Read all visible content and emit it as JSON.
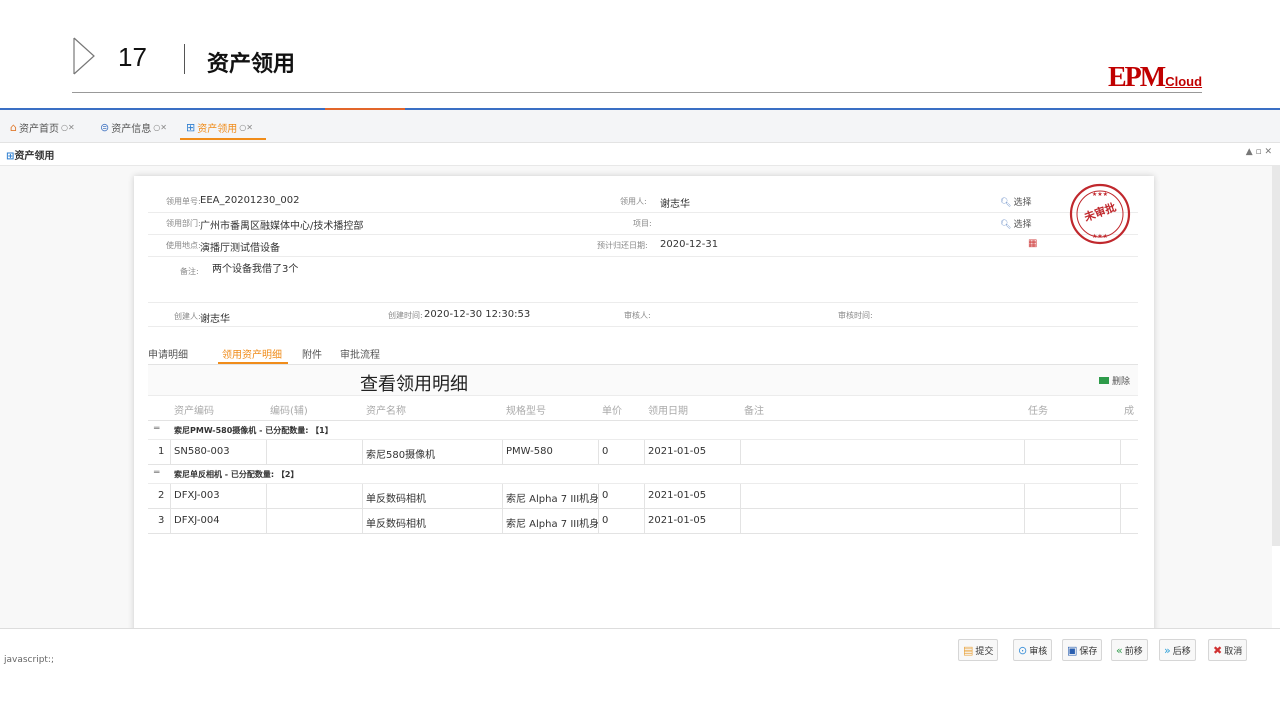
{
  "slide": {
    "number": "17",
    "title": "资产领用",
    "logo_main": "EPM",
    "logo_sub": "Cloud"
  },
  "app_tabs": [
    {
      "label": "资产首页",
      "icon": "home-icon"
    },
    {
      "label": "资产信息",
      "icon": "database-icon"
    },
    {
      "label": "资产领用",
      "icon": "requisition-icon",
      "active": true
    }
  ],
  "panel": {
    "title": "资产领用",
    "tools": "▲ ▫ ✕"
  },
  "form": {
    "order_no": {
      "label": "领用单号:",
      "value": "EEA_20201230_002"
    },
    "dept": {
      "label": "领用部门:",
      "value": "广州市番禺区融媒体中心/技术播控部"
    },
    "location": {
      "label": "使用地点:",
      "value": "演播厅测试借设备"
    },
    "remark": {
      "label": "备注:",
      "value": "两个设备我借了3个"
    },
    "user": {
      "label": "领用人:",
      "value": "谢志华"
    },
    "project": {
      "label": "项目:",
      "value": ""
    },
    "return_date": {
      "label": "预计归还日期:",
      "value": "2020-12-31"
    },
    "select_label": "选择",
    "creator": {
      "label": "创建人:",
      "value": "谢志华"
    },
    "create_time": {
      "label": "创建时间:",
      "value": "2020-12-30 12:30:53"
    },
    "reviewer": {
      "label": "审核人:",
      "value": ""
    },
    "review_time": {
      "label": "审核时间:",
      "value": ""
    },
    "stamp_text": "未审批"
  },
  "sub_tabs": [
    {
      "label": "申请明细"
    },
    {
      "label": "领用资产明细",
      "active": true
    },
    {
      "label": "附件"
    },
    {
      "label": "审批流程"
    }
  ],
  "delete_label": "删除",
  "callout": "查看领用明细",
  "table": {
    "headers": [
      "资产编码",
      "编码(辅)",
      "资产名称",
      "规格型号",
      "单价",
      "领用日期",
      "备注",
      "任务",
      "成"
    ],
    "groups": [
      {
        "title": "索尼PMW-580摄像机 - 已分配数量: 【1】",
        "rows": [
          {
            "no": "1",
            "code": "SN580-003",
            "code2": "",
            "name": "索尼580摄像机",
            "model": "PMW-580",
            "price": "0",
            "date": "2021-01-05",
            "remark": ""
          }
        ]
      },
      {
        "title": "索尼单反相机 - 已分配数量: 【2】",
        "rows": [
          {
            "no": "2",
            "code": "DFXJ-003",
            "code2": "",
            "name": "单反数码相机",
            "model": "索尼 Alpha 7 III机身",
            "price": "0",
            "date": "2021-01-05",
            "remark": ""
          },
          {
            "no": "3",
            "code": "DFXJ-004",
            "code2": "",
            "name": "单反数码相机",
            "model": "索尼 Alpha 7 III机身",
            "price": "0",
            "date": "2021-01-05",
            "remark": ""
          }
        ]
      }
    ]
  },
  "footer": {
    "status": "javascript:;",
    "buttons": [
      {
        "label": "提交",
        "icon": "submit-icon"
      },
      {
        "label": "审核",
        "icon": "check-circle-icon"
      },
      {
        "label": "保存",
        "icon": "save-icon"
      },
      {
        "label": "前移",
        "icon": "double-left-icon"
      },
      {
        "label": "后移",
        "icon": "double-right-icon"
      },
      {
        "label": "取消",
        "icon": "cancel-icon"
      }
    ]
  },
  "colors": {
    "accent": "#f08c1a",
    "header_blue": "#3a6fc4",
    "brand_red": "#c00000",
    "stamp_red": "#c0282d"
  }
}
